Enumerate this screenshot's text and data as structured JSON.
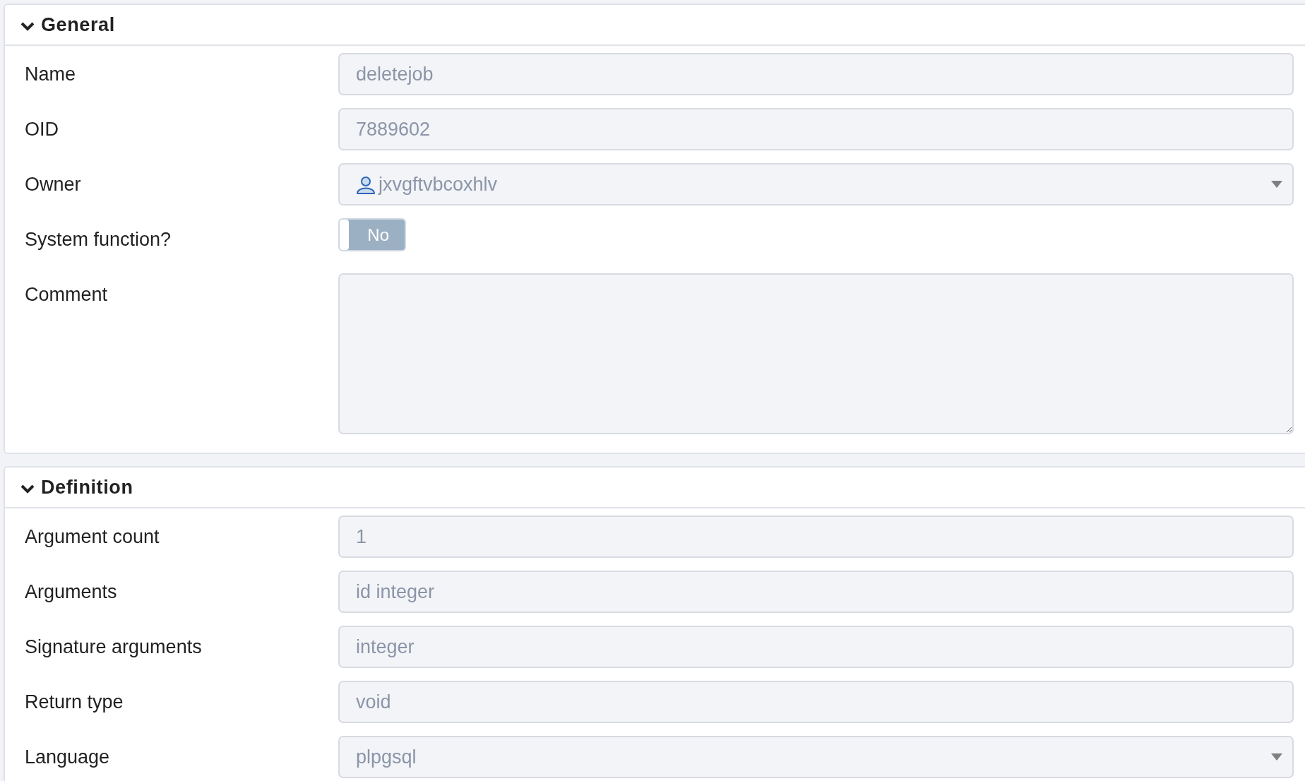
{
  "sections": [
    {
      "title": "General",
      "expanded": true,
      "fields": [
        {
          "kind": "text",
          "label": "Name",
          "value": "deletejob"
        },
        {
          "kind": "text",
          "label": "OID",
          "value": "7889602"
        },
        {
          "kind": "userselect",
          "label": "Owner",
          "value": "jxvgftvbcoxhlv"
        },
        {
          "kind": "switch",
          "label": "System function?",
          "on": false,
          "text": "No"
        },
        {
          "kind": "textarea",
          "label": "Comment"
        }
      ]
    },
    {
      "title": "Definition",
      "expanded": true,
      "fields": [
        {
          "kind": "text",
          "label": "Argument count",
          "value": "1"
        },
        {
          "kind": "text",
          "label": "Arguments",
          "value": "id integer"
        },
        {
          "kind": "text",
          "label": "Signature arguments",
          "value": "integer"
        },
        {
          "kind": "text",
          "label": "Return type",
          "value": "void"
        },
        {
          "kind": "select",
          "label": "Language",
          "value": "plpgsql"
        }
      ]
    }
  ]
}
